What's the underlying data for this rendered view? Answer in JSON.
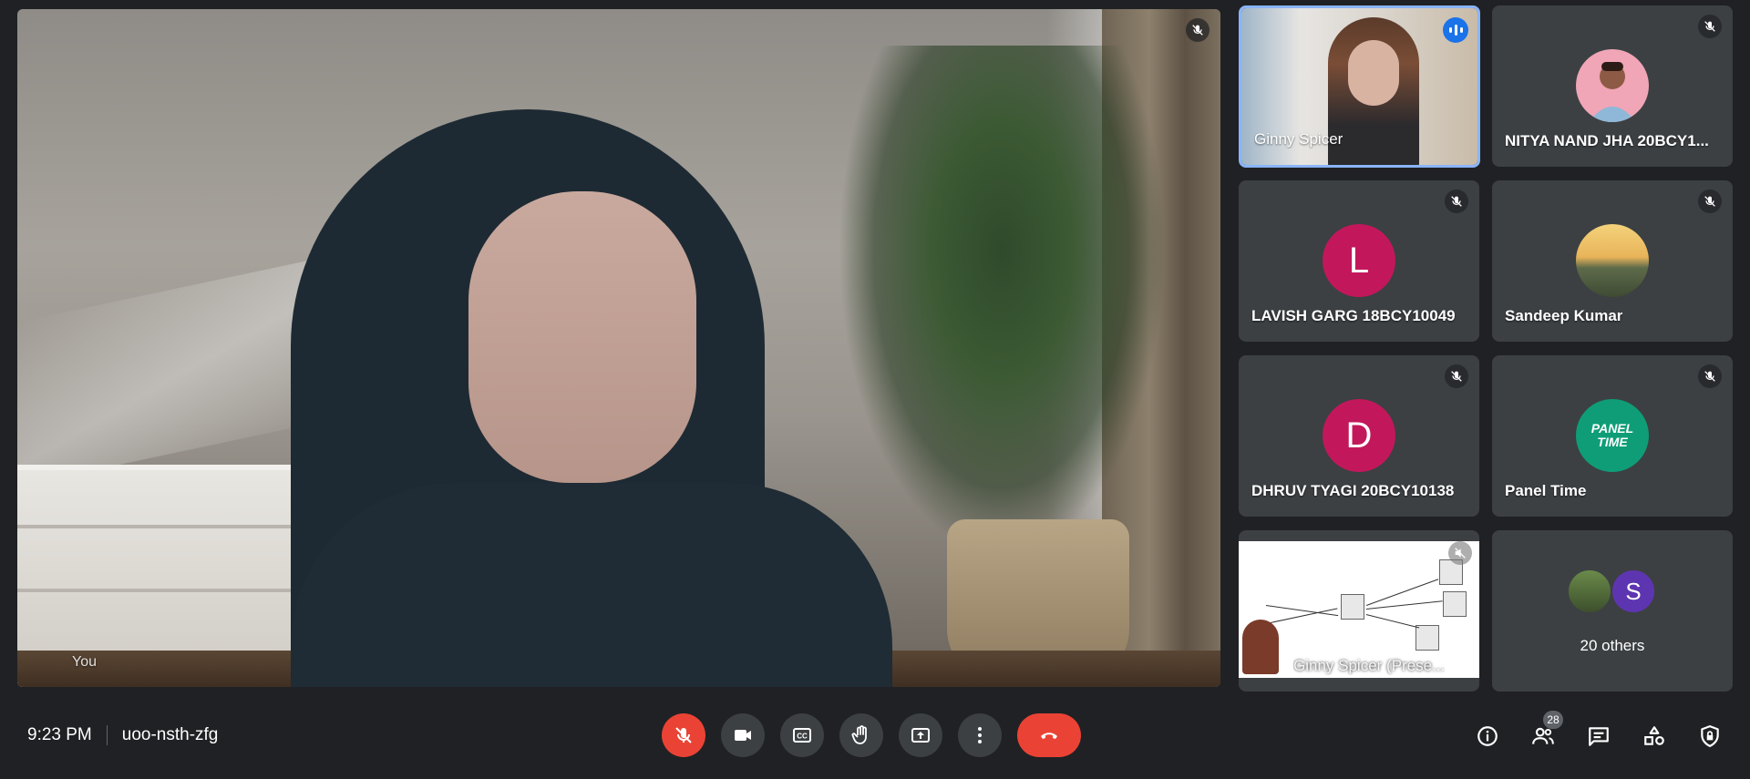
{
  "main": {
    "self_label": "You",
    "mic_icon": "mic-off-icon"
  },
  "participants": [
    {
      "name": "Ginny Spicer",
      "kind": "video",
      "speaking": true
    },
    {
      "name": "NITYA NAND JHA 20BCY1...",
      "kind": "photo",
      "muted": true
    },
    {
      "name": "LAVISH GARG 18BCY10049",
      "kind": "letter",
      "letter": "L",
      "color": "#c2185b",
      "muted": true
    },
    {
      "name": "Sandeep Kumar",
      "kind": "photo",
      "muted": true
    },
    {
      "name": "DHRUV TYAGI 20BCY10138",
      "kind": "letter",
      "letter": "D",
      "color": "#c2185b",
      "muted": true
    },
    {
      "name": "Panel Time",
      "kind": "logo",
      "logo_text": "PANEL TIME",
      "muted": true
    }
  ],
  "presentation": {
    "label": "Ginny Spicer (Prese..."
  },
  "others": {
    "label": "20 others",
    "avatar_letter": "S",
    "avatar_color": "#5e35b1"
  },
  "bottom_bar": {
    "time": "9:23 PM",
    "meeting_code": "uoo-nsth-zfg",
    "people_count": "28",
    "controls": [
      "mic-off-icon",
      "camera-icon",
      "captions-icon",
      "raise-hand-icon",
      "present-icon",
      "more-options-icon",
      "end-call-icon"
    ],
    "right_icons": [
      "info-icon",
      "people-icon",
      "chat-icon",
      "activities-icon",
      "host-controls-icon"
    ]
  },
  "colors": {
    "background": "#202124",
    "tile": "#3c4043",
    "danger": "#ea4335",
    "speaking_border": "#8ab4f8"
  }
}
